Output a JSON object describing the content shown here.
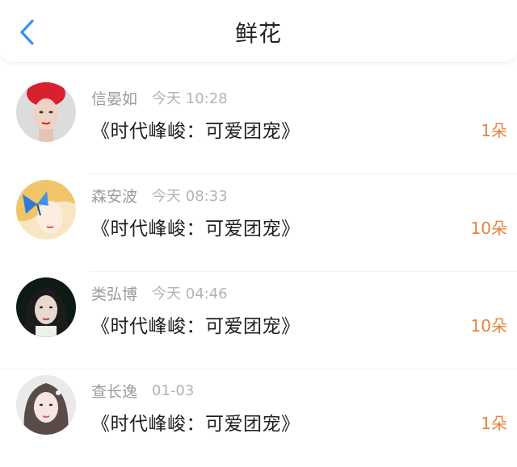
{
  "header": {
    "title": "鲜花",
    "back_icon": "chevron-left-icon"
  },
  "colors": {
    "accent": "#3b8ff5",
    "count": "#e8823a"
  },
  "items": [
    {
      "name": "信晏如",
      "time": "今天 10:28",
      "book": "《时代峰峻：可爱团宠》",
      "count": "1朵"
    },
    {
      "name": "森安波",
      "time": "今天 08:33",
      "book": "《时代峰峻：可爱团宠》",
      "count": "10朵"
    },
    {
      "name": "类弘博",
      "time": "今天 04:46",
      "book": "《时代峰峻：可爱团宠》",
      "count": "10朵"
    },
    {
      "name": "查长逸",
      "time": "01-03",
      "book": "《时代峰峻：可爱团宠》",
      "count": "1朵"
    }
  ]
}
